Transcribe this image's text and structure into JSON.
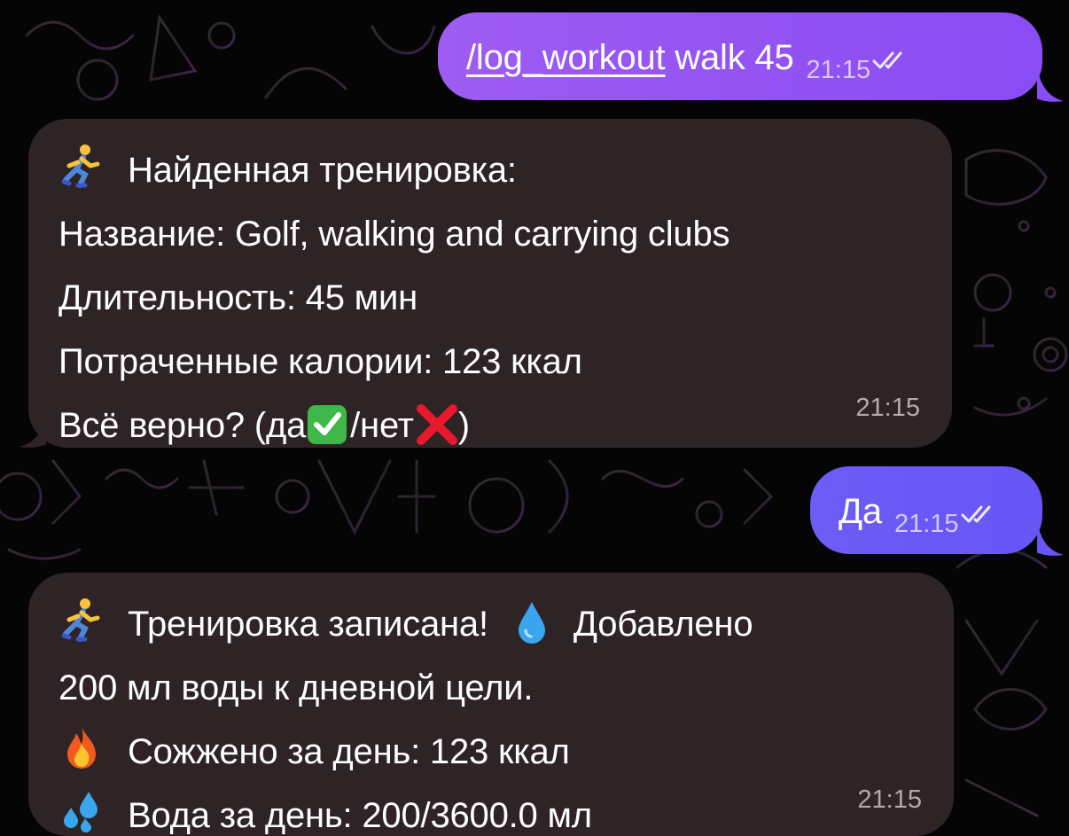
{
  "messages": [
    {
      "direction": "outgoing",
      "command": "/log_workout",
      "text": " walk 45",
      "time": "21:15",
      "status": "read"
    },
    {
      "direction": "incoming",
      "lines": [
        {
          "icon": "runner-icon",
          "text": "Найденная тренировка:"
        },
        {
          "text": "Название: Golf, walking and carrying clubs"
        },
        {
          "text": "Длительность: 45 мин"
        },
        {
          "text": "Потраченные калории: 123 ккал"
        },
        {
          "text_before": "Всё верно? (да",
          "icon1": "check-mark-button-icon",
          "text_mid": "/нет",
          "icon2": "cross-mark-icon",
          "text_after": ")"
        }
      ],
      "time": "21:15"
    },
    {
      "direction": "outgoing",
      "text": "Да",
      "time": "21:15",
      "status": "read"
    },
    {
      "direction": "incoming",
      "lines": [
        {
          "icon": "runner-icon",
          "text": "Тренировка записана!",
          "icon2": "droplet-icon",
          "text2": "Добавлено"
        },
        {
          "text": "200 мл воды к дневной цели."
        },
        {
          "icon": "fire-icon",
          "text": "Сожжено за день: 123 ккал"
        },
        {
          "icon": "sweat-droplets-icon",
          "text": "Вода за день: 200/3600.0 мл"
        }
      ],
      "time": "21:15"
    }
  ],
  "colors": {
    "background": "#050505",
    "incoming_bubble": "#2e2426",
    "outgoing_bubble_1": "#9e5cf2",
    "outgoing_bubble_2": "#6e5cf6"
  }
}
